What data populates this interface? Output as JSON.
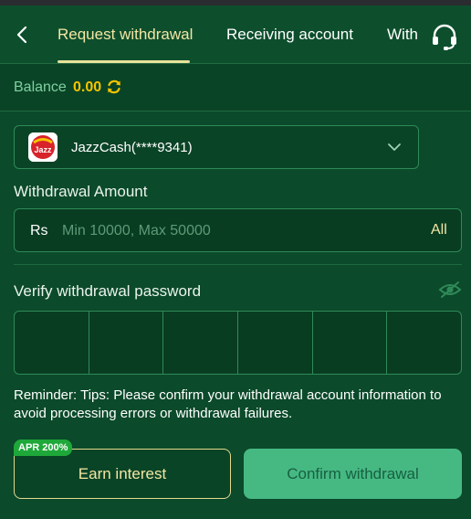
{
  "header": {
    "tabs": [
      {
        "label": "Request withdrawal",
        "active": true
      },
      {
        "label": "Receiving account",
        "active": false
      },
      {
        "label": "With",
        "active": false
      }
    ],
    "back_icon": "chevron-left-icon",
    "support_icon": "headset-icon"
  },
  "balance": {
    "label": "Balance",
    "value": "0.00",
    "refresh_icon": "refresh-icon"
  },
  "account": {
    "provider_logo": "jazzcash-logo",
    "logo_text": "Jazz",
    "name": "JazzCash(****9341)"
  },
  "amount": {
    "title": "Withdrawal Amount",
    "currency": "Rs",
    "placeholder": "Min 10000, Max 50000",
    "all_label": "All"
  },
  "password": {
    "title": "Verify withdrawal password",
    "eye_icon": "eye-off-icon",
    "cells": [
      "",
      "",
      "",
      "",
      "",
      ""
    ]
  },
  "reminder": "Reminder: Tips: Please confirm your withdrawal account information to avoid processing errors or withdrawal failures.",
  "buttons": {
    "apr_badge": "APR 200%",
    "earn": "Earn interest",
    "confirm": "Confirm withdrawal"
  },
  "colors": {
    "background": "#0b4a2a",
    "accent_text": "#f3e6a3",
    "balance_value": "#f5c400",
    "confirm_button": "#46b983",
    "apr_badge": "#1fa83a"
  }
}
